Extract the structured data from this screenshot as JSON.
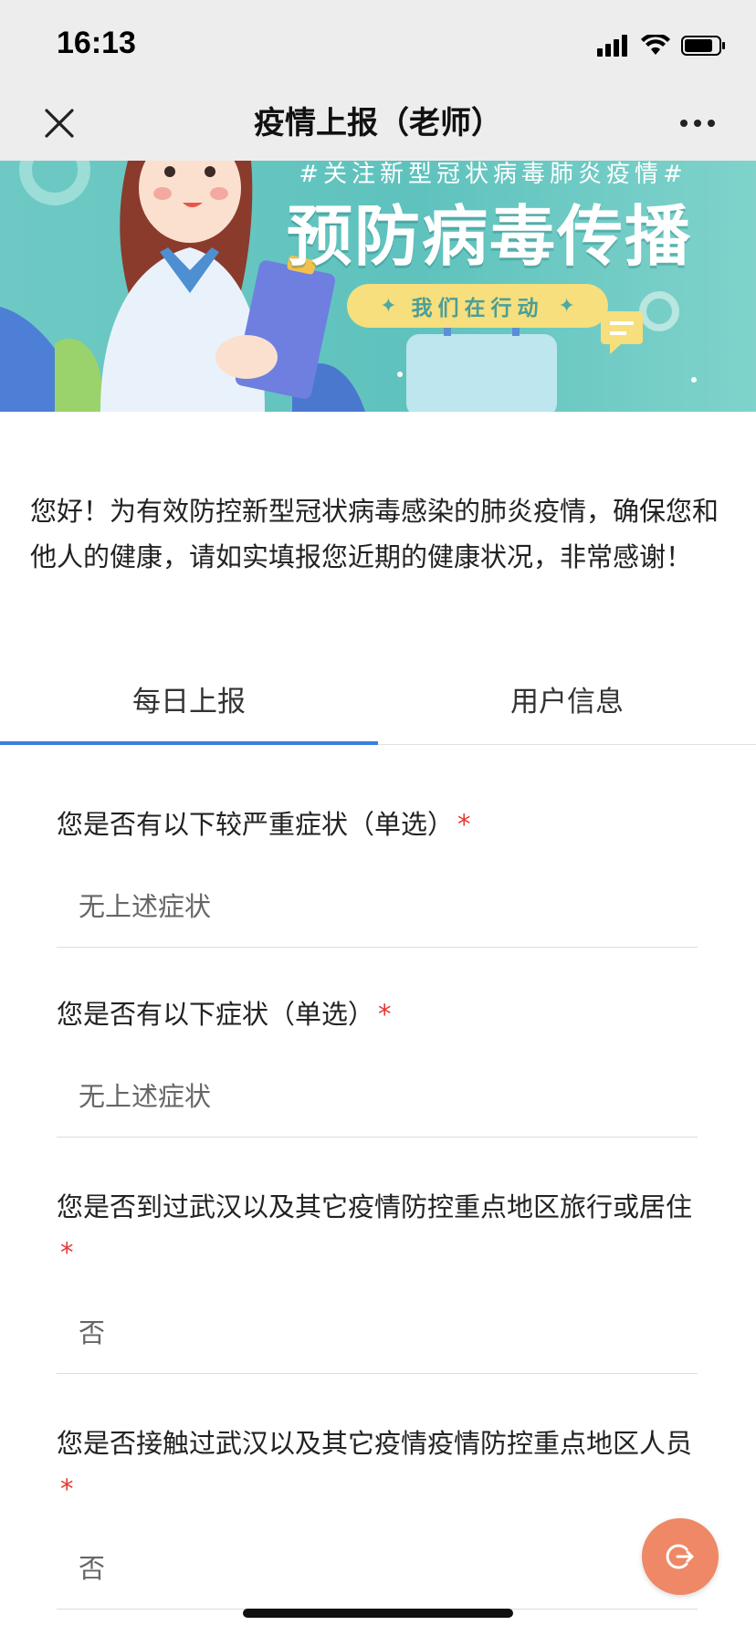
{
  "status_bar": {
    "time": "16:13"
  },
  "nav": {
    "title": "疫情上报（老师）",
    "close_icon": "close-icon",
    "more_icon": "more-horizontal-icon"
  },
  "banner": {
    "hashtag": "#关注新型冠状病毒肺炎疫情#",
    "headline": "预防病毒传播",
    "pill_text": "我们在行动"
  },
  "intro_text": "您好！为有效防控新型冠状病毒感染的肺炎疫情，确保您和他人的健康，请如实填报您近期的健康状况，非常感谢！",
  "tabs": [
    {
      "label": "每日上报",
      "active": true
    },
    {
      "label": "用户信息",
      "active": false
    }
  ],
  "questions": [
    {
      "label": "您是否有以下较严重症状（单选）",
      "required_mark": "*",
      "answer": "无上述症状"
    },
    {
      "label": "您是否有以下症状（单选）",
      "required_mark": "*",
      "answer": "无上述症状"
    },
    {
      "label": "您是否到过武汉以及其它疫情防控重点地区旅行或居住",
      "required_mark": "*",
      "answer": "否"
    },
    {
      "label": "您是否接触过武汉以及其它疫情疫情防控重点地区人员",
      "required_mark": "*",
      "answer": "否"
    }
  ],
  "colors": {
    "accent": "#3a7fe0",
    "required": "#e53935",
    "fab": "#ee8866",
    "banner": "#5fc2bd"
  }
}
